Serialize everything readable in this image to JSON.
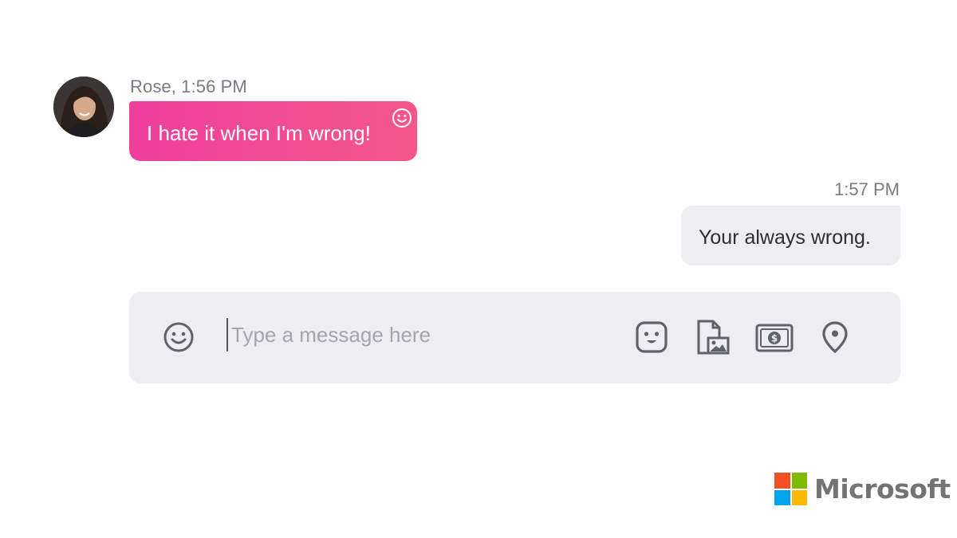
{
  "conversation": {
    "incoming": {
      "sender_meta": "Rose, 1:56 PM",
      "text": "I hate it when I'm wrong!",
      "reaction_icon": "smiley-outline-icon"
    },
    "outgoing": {
      "timestamp": "1:57 PM",
      "text": "Your always wrong."
    }
  },
  "composer": {
    "placeholder": "Type a message here",
    "value": "",
    "icons": [
      "emoji-icon",
      "sticker-icon",
      "image-attach-icon",
      "money-icon",
      "location-pin-icon"
    ]
  },
  "brand": {
    "wordmark": "Microsoft",
    "colors": [
      "#f25022",
      "#7fba00",
      "#00a4ef",
      "#ffb900"
    ]
  },
  "theme": {
    "accent_gradient_start": "#ee3f9d",
    "accent_gradient_end": "#f4578a",
    "bubble_grey": "#eeedf2",
    "meta_text": "#777b82"
  }
}
